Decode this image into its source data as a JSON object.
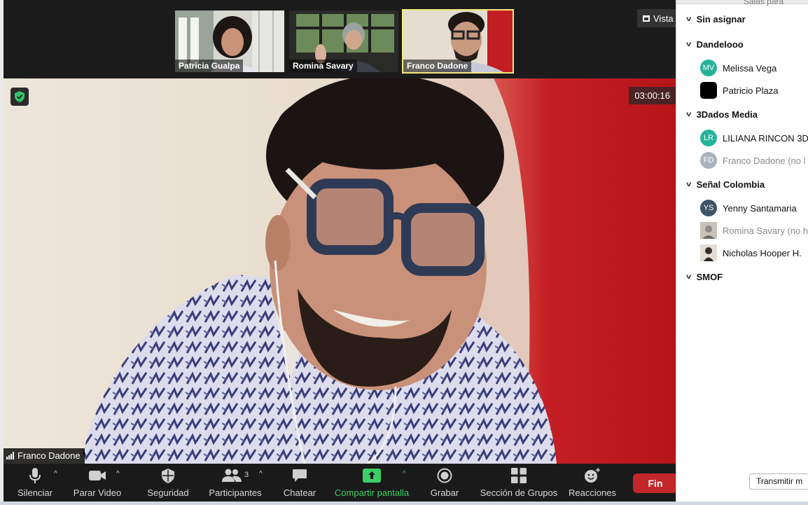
{
  "thumbnails": [
    {
      "name": "Patricia Gualpa",
      "active": false
    },
    {
      "name": "Romina Savary",
      "active": false
    },
    {
      "name": "Franco Dadone",
      "active": true
    }
  ],
  "view_button": {
    "label": "Vista",
    "icon": "grid-icon"
  },
  "main_video": {
    "speaker_name": "Franco Dadone",
    "timer": "03:00:16",
    "security_icon": "shield-check-icon",
    "signal_icon": "signal-bars-icon"
  },
  "toolbar": {
    "mute": {
      "label": "Silenciar",
      "icon": "microphone-icon"
    },
    "video": {
      "label": "Parar Video",
      "icon": "video-camera-icon"
    },
    "security": {
      "label": "Seguridad",
      "icon": "shield-icon"
    },
    "participants": {
      "label": "Participantes",
      "count": "3",
      "icon": "people-icon"
    },
    "chat": {
      "label": "Chatear",
      "icon": "chat-bubble-icon"
    },
    "share": {
      "label": "Compartir pantalla",
      "icon": "share-screen-icon",
      "color": "#3ad066"
    },
    "record": {
      "label": "Grabar",
      "icon": "record-icon"
    },
    "breakout": {
      "label": "Sección de Grupos",
      "icon": "grid-four-icon"
    },
    "reactions": {
      "label": "Reacciones",
      "icon": "emoji-plus-icon"
    },
    "end": {
      "label": "Fin",
      "color": "#c2262b"
    }
  },
  "panel": {
    "title": "Salas para",
    "rooms": [
      {
        "name": "Sin asignar",
        "members": []
      },
      {
        "name": "Dandelooo",
        "members": [
          {
            "name": "Melissa Vega",
            "initials": "MV",
            "color": "#26b39a",
            "dim": false
          },
          {
            "name": "Patricio Plaza",
            "initials": "",
            "color": "#000000",
            "dim": false
          }
        ]
      },
      {
        "name": "3Dados Media",
        "members": [
          {
            "name": "LILIANA RINCON 3D",
            "initials": "LR",
            "color": "#26b39a",
            "dim": false
          },
          {
            "name": "Franco Dadone (no l",
            "initials": "FD",
            "color": "#a9b3bd",
            "dim": true
          }
        ]
      },
      {
        "name": "Señal Colombia",
        "members": [
          {
            "name": "Yenny Santamaria",
            "initials": "YS",
            "color": "#3e5366",
            "dim": false
          },
          {
            "name": "Romina Savary (no h",
            "initials": "",
            "color": "#b8b0a6",
            "dim": true
          },
          {
            "name": "Nicholas Hooper H.",
            "initials": "",
            "color": "#d9d4cc",
            "dim": false
          }
        ]
      },
      {
        "name": "SMOF",
        "members": []
      }
    ],
    "broadcast_label": "Transmitir m"
  }
}
